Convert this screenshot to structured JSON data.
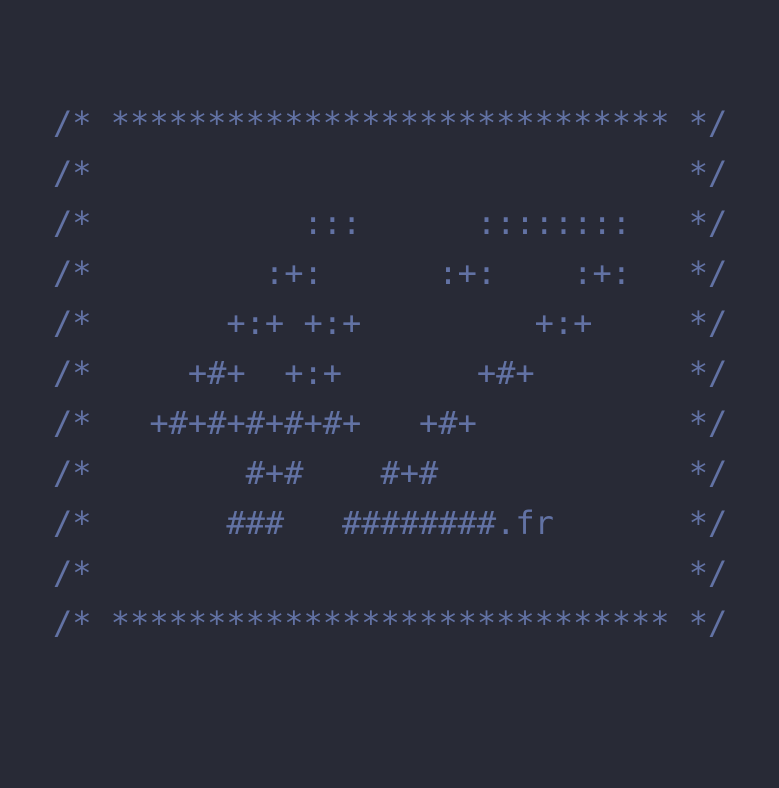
{
  "colors": {
    "background": "#282a36",
    "comment_text": "#6272a4"
  },
  "header": {
    "lines": [
      "/* ***************************** */",
      "/*                               */",
      "/*           :::      ::::::::   */",
      "/*         :+:      :+:    :+:   */",
      "/*       +:+ +:+         +:+     */",
      "/*     +#+  +:+       +#+        */",
      "/*   +#+#+#+#+#+   +#+           */",
      "/*        #+#    #+#             */",
      "/*       ###   ########.fr       */",
      "/*                               */",
      "/* ***************************** */"
    ]
  }
}
